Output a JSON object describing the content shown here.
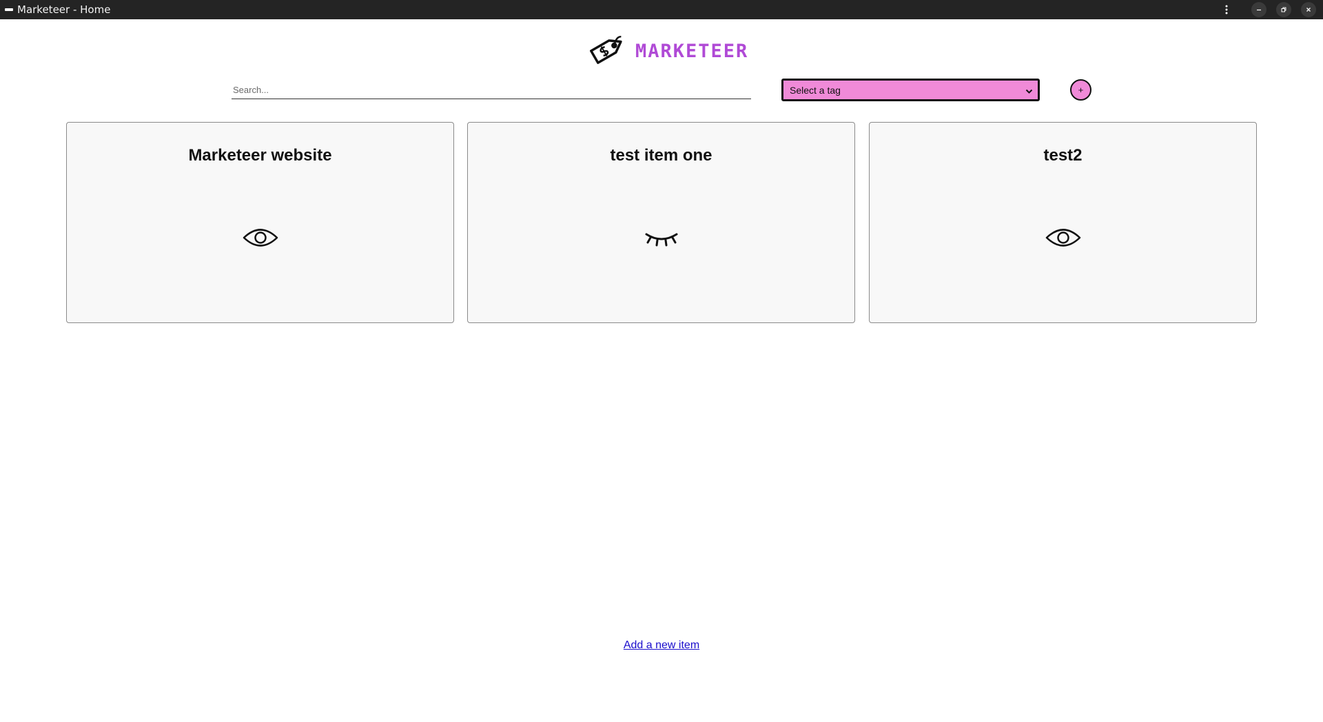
{
  "window": {
    "title": "Marketeer - Home"
  },
  "header": {
    "logo_text": "MARKETEER",
    "logo_icon": "price-tag-icon",
    "brand_color": "#b04ad6"
  },
  "controls": {
    "search_placeholder": "Search...",
    "search_value": "",
    "tag_select_label": "Select a tag",
    "plus_label": "+",
    "accent_color": "#f08ad8"
  },
  "items": [
    {
      "title": "Marketeer website",
      "visibility_icon": "eye-open-icon"
    },
    {
      "title": "test item one",
      "visibility_icon": "eye-closed-icon"
    },
    {
      "title": "test2",
      "visibility_icon": "eye-open-icon"
    }
  ],
  "footer": {
    "add_link": "Add a new item"
  }
}
